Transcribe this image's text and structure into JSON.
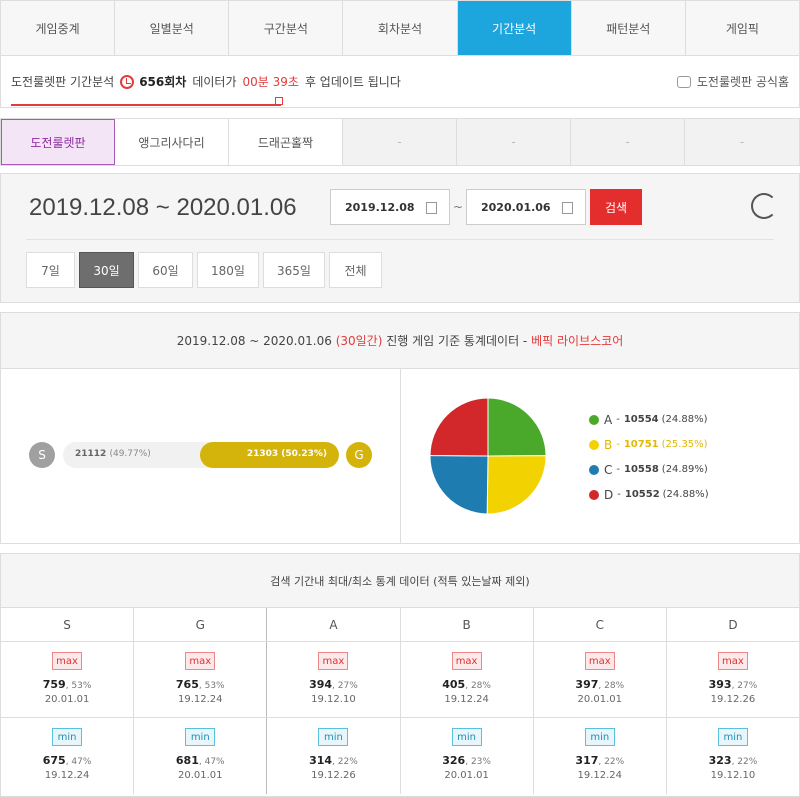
{
  "top_tabs": [
    "게임중계",
    "일별분석",
    "구간분석",
    "회차분석",
    "기간분석",
    "패턴분석",
    "게임픽"
  ],
  "top_tabs_active": 4,
  "info": {
    "prefix": "도전룰렛판 기간분석",
    "round": "656회차",
    "middle": "데이터가",
    "countdown": "00분 39초",
    "suffix": "후 업데이트 됩니다",
    "official": "도전룰렛판 공식홈"
  },
  "game_tabs": [
    "도전룰렛판",
    "앵그리사다리",
    "드래곤홀짝",
    "-",
    "-",
    "-",
    "-"
  ],
  "date": {
    "range_display": "2019.12.08 ~ 2020.01.06",
    "from": "2019.12.08",
    "to": "2020.01.06",
    "tilde": "~",
    "search_label": "검색",
    "periods": [
      "7일",
      "30일",
      "60일",
      "180일",
      "365일",
      "전체"
    ],
    "period_active": 1
  },
  "stats": {
    "range": "2019.12.08 ~ 2020.01.06",
    "days": "(30일간)",
    "desc": "진행 게임 기준 통계데이터 -",
    "source": "베픽 라이브스코어",
    "s_label": "S",
    "g_label": "G",
    "s_value": "21112",
    "s_pct": "(49.77%)",
    "g_value": "21303",
    "g_pct": "(50.23%)",
    "g_share": 50.23,
    "legend": [
      {
        "letter": "A",
        "dash": "-",
        "value": "10554",
        "pct": "(24.88%)",
        "color": "#4aa82a"
      },
      {
        "letter": "B",
        "dash": "-",
        "value": "10751",
        "pct": "(25.35%)",
        "color": "#f2d200"
      },
      {
        "letter": "C",
        "dash": "-",
        "value": "10558",
        "pct": "(24.89%)",
        "color": "#1f7cb0"
      },
      {
        "letter": "D",
        "dash": "-",
        "value": "10552",
        "pct": "(24.88%)",
        "color": "#d2282c"
      }
    ]
  },
  "chart_data": {
    "type": "pie",
    "categories": [
      "A",
      "B",
      "C",
      "D"
    ],
    "values": [
      10554,
      10751,
      10558,
      10552
    ],
    "colors": [
      "#4aa82a",
      "#f2d200",
      "#1f7cb0",
      "#d2282c"
    ]
  },
  "table": {
    "title": "검색 기간내 최대/최소 통계 데이터 (적특 있는날짜 제외)",
    "columns": [
      "S",
      "G",
      "A",
      "B",
      "C",
      "D"
    ],
    "max_label": "max",
    "min_label": "min",
    "max": [
      {
        "num": "759",
        "pct": ", 53%",
        "date": "20.01.01"
      },
      {
        "num": "765",
        "pct": ", 53%",
        "date": "19.12.24"
      },
      {
        "num": "394",
        "pct": ", 27%",
        "date": "19.12.10"
      },
      {
        "num": "405",
        "pct": ", 28%",
        "date": "19.12.24"
      },
      {
        "num": "397",
        "pct": ", 28%",
        "date": "20.01.01"
      },
      {
        "num": "393",
        "pct": ", 27%",
        "date": "19.12.26"
      }
    ],
    "min": [
      {
        "num": "675",
        "pct": ", 47%",
        "date": "19.12.24"
      },
      {
        "num": "681",
        "pct": ", 47%",
        "date": "20.01.01"
      },
      {
        "num": "314",
        "pct": ", 22%",
        "date": "19.12.26"
      },
      {
        "num": "326",
        "pct": ", 23%",
        "date": "20.01.01"
      },
      {
        "num": "317",
        "pct": ", 22%",
        "date": "19.12.24"
      },
      {
        "num": "323",
        "pct": ", 22%",
        "date": "19.12.10"
      }
    ]
  }
}
